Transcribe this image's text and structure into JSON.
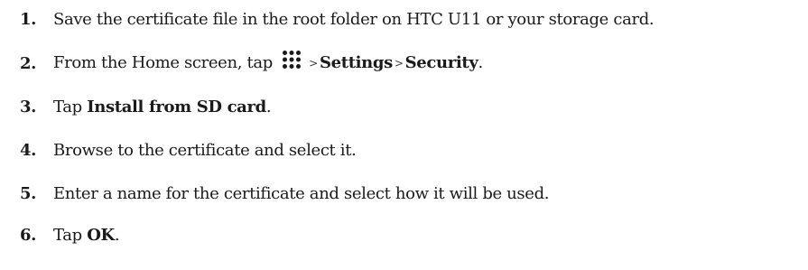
{
  "steps": [
    {
      "number": "1.",
      "text": "Save the certificate file in the root folder on HTC U11 or your storage card."
    },
    {
      "number": "2.",
      "text_before": "From the Home screen, tap",
      "icon": "apps-grid-icon",
      "arrow_1": ">",
      "settings": "Settings",
      "arrow_2": ">",
      "security": "Security",
      "end": "."
    },
    {
      "number": "3.",
      "text_before": "Tap",
      "bold": "Install from SD card",
      "end": "."
    },
    {
      "number": "4.",
      "text": "Browse to the certificate and select it."
    },
    {
      "number": "5.",
      "text": "Enter a name for the certificate and select how it will be used."
    },
    {
      "number": "6.",
      "text_before": "Tap",
      "bold": "OK",
      "end": "."
    }
  ]
}
